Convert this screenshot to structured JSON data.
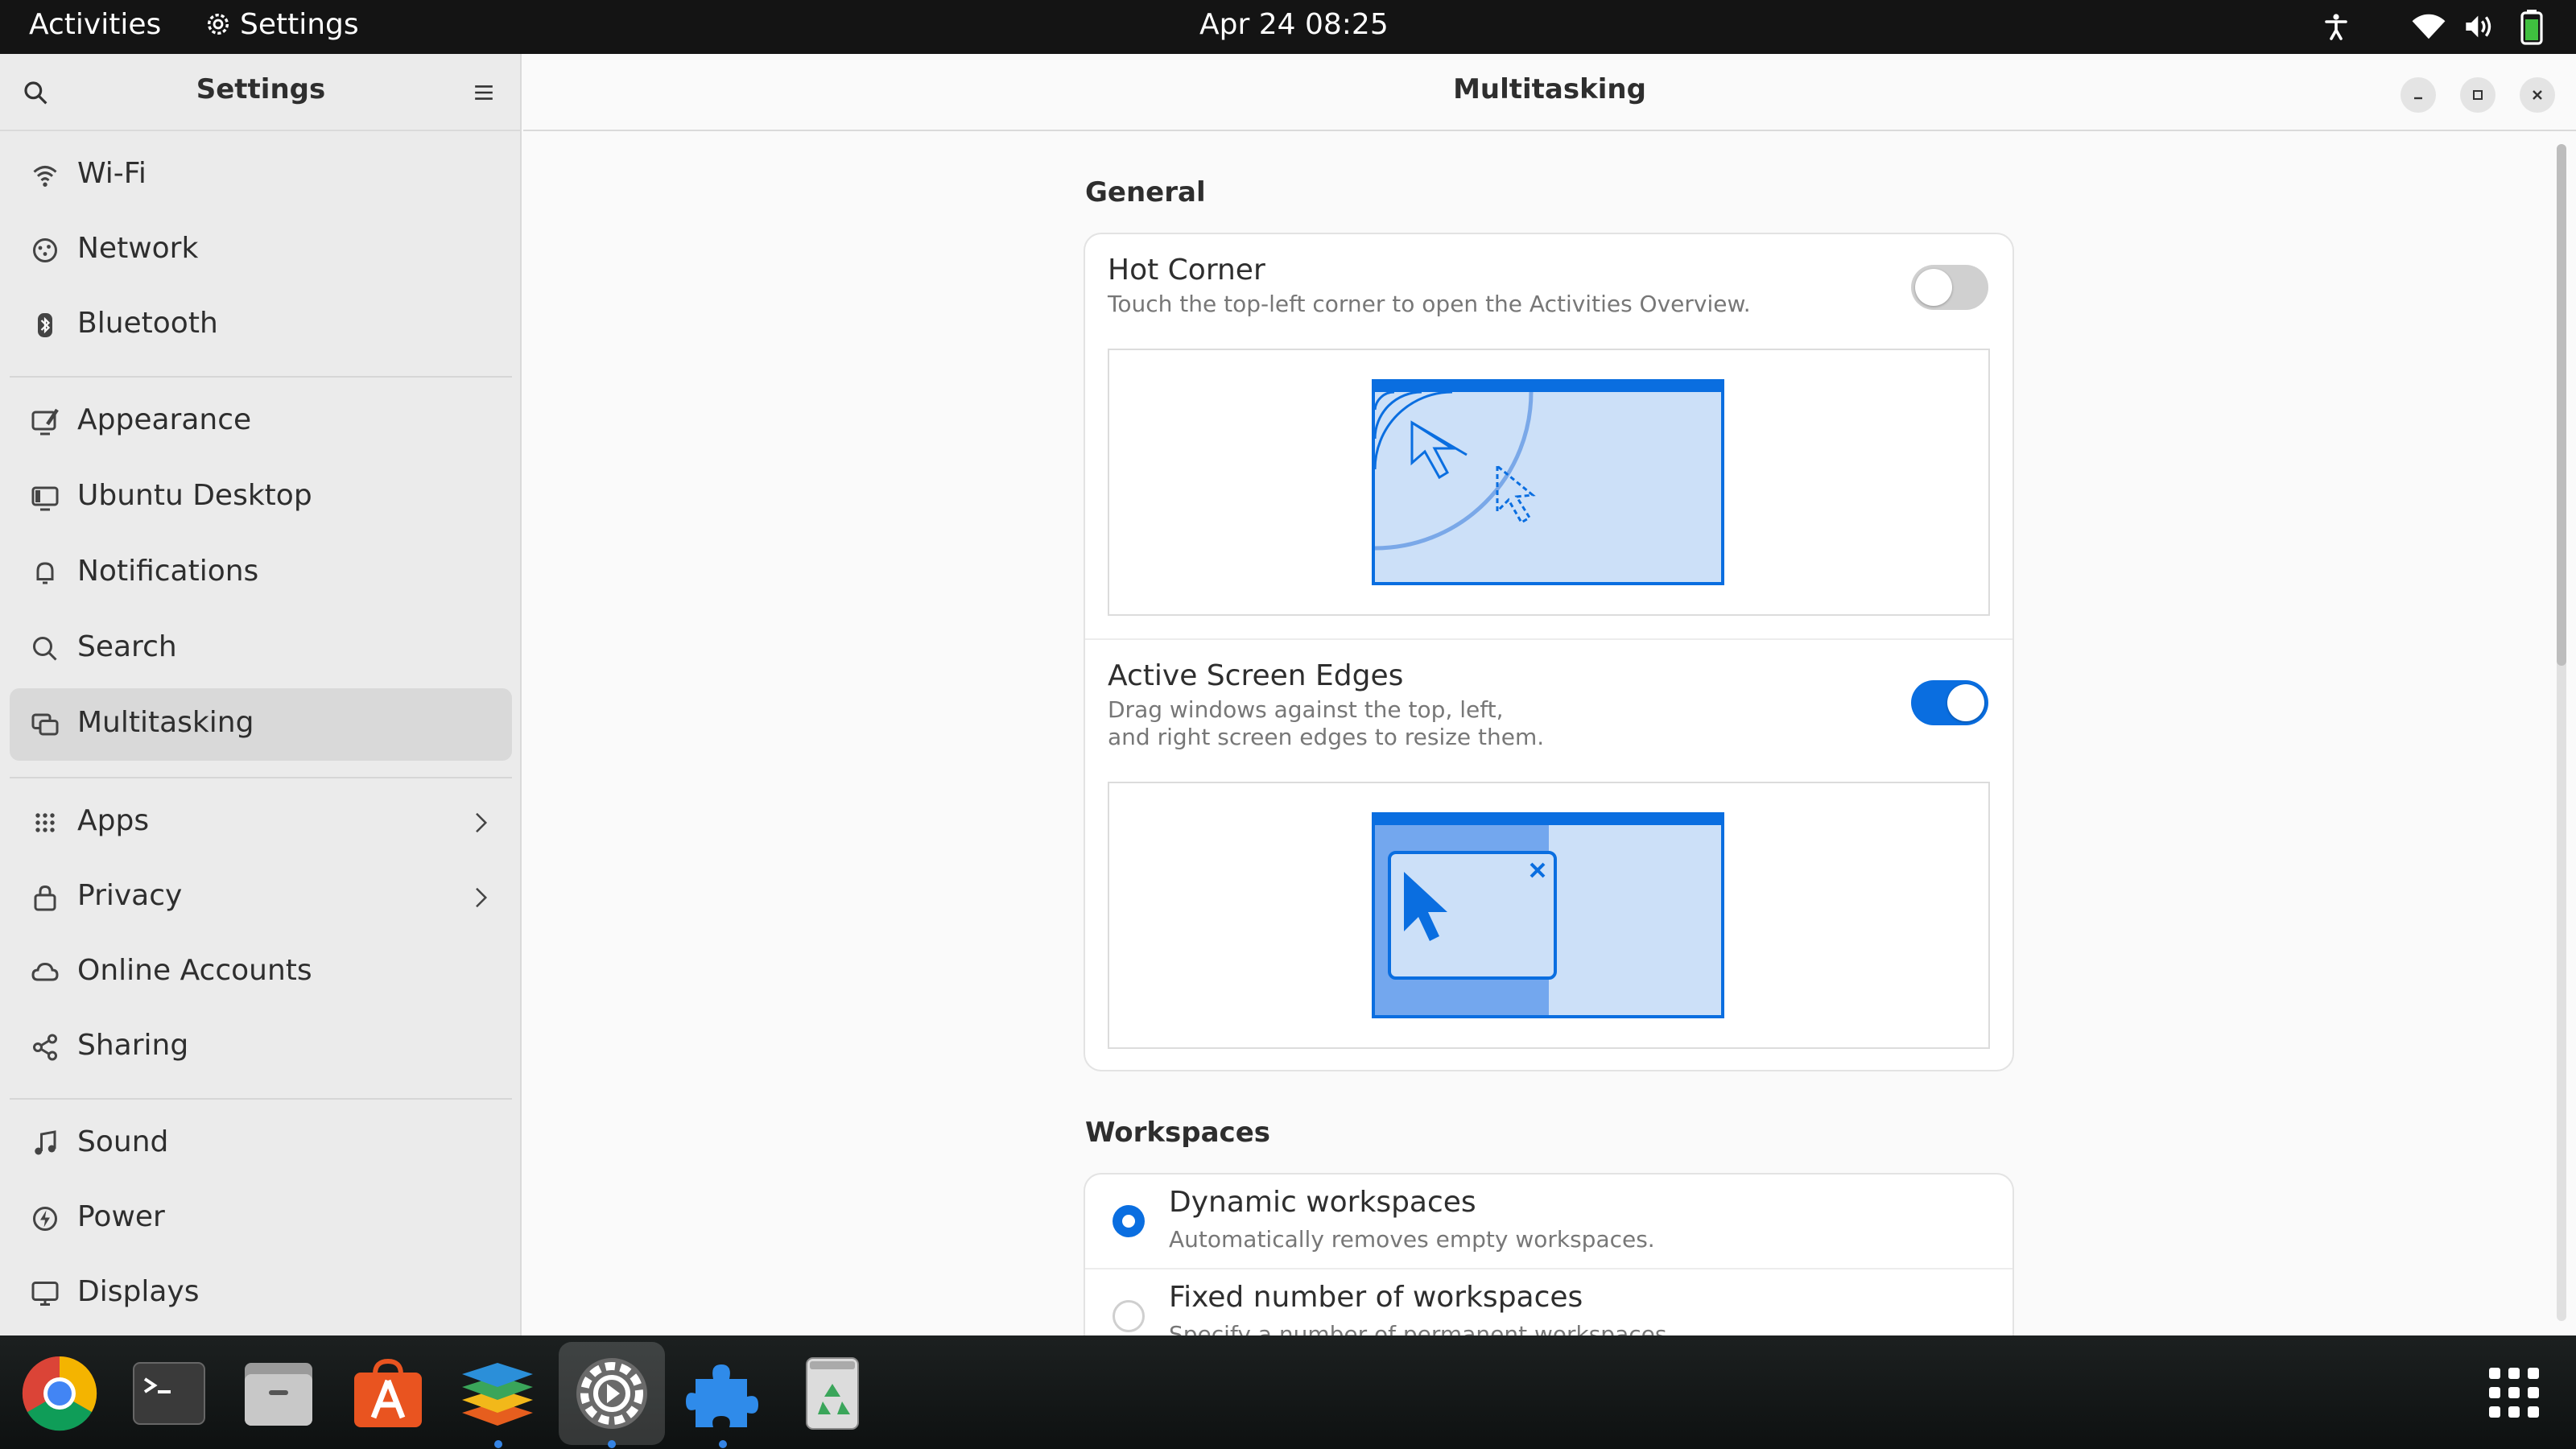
{
  "topbar": {
    "activities": "Activities",
    "app_name": "Settings",
    "datetime": "Apr 24  08:25"
  },
  "sidebar": {
    "title": "Settings",
    "items": [
      {
        "label": "Wi-Fi",
        "icon": "wifi-icon"
      },
      {
        "label": "Network",
        "icon": "network-icon"
      },
      {
        "label": "Bluetooth",
        "icon": "bluetooth-icon"
      },
      {
        "label": "Appearance",
        "icon": "appearance-icon"
      },
      {
        "label": "Ubuntu Desktop",
        "icon": "ubuntu-desktop-icon"
      },
      {
        "label": "Notifications",
        "icon": "bell-icon"
      },
      {
        "label": "Search",
        "icon": "search-icon"
      },
      {
        "label": "Multitasking",
        "icon": "multitasking-icon",
        "selected": true
      },
      {
        "label": "Apps",
        "icon": "apps-grid-icon",
        "chevron": true
      },
      {
        "label": "Privacy",
        "icon": "lock-icon",
        "chevron": true
      },
      {
        "label": "Online Accounts",
        "icon": "cloud-icon"
      },
      {
        "label": "Sharing",
        "icon": "share-icon"
      },
      {
        "label": "Sound",
        "icon": "music-note-icon"
      },
      {
        "label": "Power",
        "icon": "power-icon"
      },
      {
        "label": "Displays",
        "icon": "display-icon"
      }
    ]
  },
  "main": {
    "title": "Multitasking",
    "general": {
      "title": "General",
      "hot_corner": {
        "title": "Hot Corner",
        "subtitle": "Touch the top-left corner to open the Activities Overview.",
        "enabled": false
      },
      "active_edges": {
        "title": "Active Screen Edges",
        "subtitle_line1": "Drag windows against the top, left,",
        "subtitle_line2": "and right screen edges to resize them.",
        "enabled": true
      }
    },
    "workspaces": {
      "title": "Workspaces",
      "dynamic": {
        "title": "Dynamic workspaces",
        "subtitle": "Automatically removes empty workspaces.",
        "selected": true
      },
      "fixed": {
        "title": "Fixed number of workspaces",
        "subtitle": "Specify a number of permanent workspaces.",
        "selected": false
      }
    }
  },
  "dock": {
    "apps": [
      "chrome",
      "terminal",
      "files",
      "app-center",
      "layers-app",
      "settings",
      "extensions",
      "trash"
    ],
    "running": [
      "layers-app",
      "settings",
      "extensions"
    ]
  },
  "colors": {
    "accent": "#0a6ee0",
    "illustration_fill": "#cce0f8",
    "illustration_dark": "#73a7ee",
    "topbar": "#141414"
  }
}
